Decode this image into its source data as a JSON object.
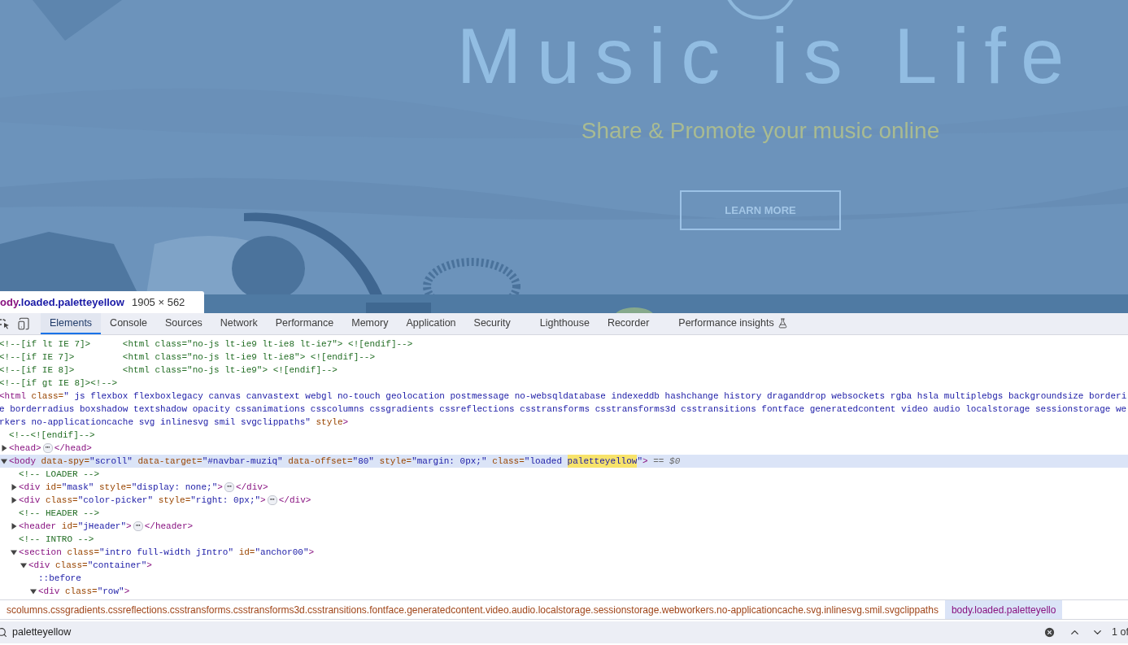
{
  "page": {
    "title": "Music is Life",
    "subtitle": "Share & Promote your music online",
    "button": "LEARN MORE"
  },
  "inspect_tooltip": {
    "tag": "ody",
    "classes": ".loaded.paletteyellow",
    "size": "1905 × 562"
  },
  "tabs": [
    {
      "label": "Elements",
      "selected": true
    },
    {
      "label": "Console",
      "selected": false
    },
    {
      "label": "Sources",
      "selected": false
    },
    {
      "label": "Network",
      "selected": false
    },
    {
      "label": "Performance",
      "selected": false
    },
    {
      "label": "Memory",
      "selected": false
    },
    {
      "label": "Application",
      "selected": false
    },
    {
      "label": "Security",
      "selected": false
    },
    {
      "label": "Lighthouse",
      "selected": false
    },
    {
      "label": "Recorder",
      "selected": false
    },
    {
      "label": "Performance insights",
      "selected": false,
      "experimental": true
    }
  ],
  "dom": [
    {
      "selected": false,
      "lines": [
        {
          "parts": [
            {
              "kind": "comment",
              "text": "<!--[if lt IE 7]>      <html class=\"no-js lt-ie9 lt-ie8 lt-ie7\"> <![endif]-->"
            }
          ]
        }
      ]
    },
    {
      "selected": false,
      "lines": [
        {
          "parts": [
            {
              "kind": "comment",
              "text": "<!--[if IE 7]>         <html class=\"no-js lt-ie9 lt-ie8\"> <![endif]-->"
            }
          ]
        }
      ]
    },
    {
      "selected": false,
      "lines": [
        {
          "parts": [
            {
              "kind": "comment",
              "text": "<!--[if IE 8]>         <html class=\"no-js lt-ie9\"> <![endif]-->"
            }
          ]
        }
      ]
    },
    {
      "selected": false,
      "lines": [
        {
          "parts": [
            {
              "kind": "comment",
              "text": "<!--[if gt IE 8]><!-->"
            }
          ]
        }
      ]
    },
    {
      "selected": false,
      "lines": [
        {
          "parts": [
            {
              "kind": "tag",
              "text": "<html"
            },
            {
              "kind": "attr",
              "text": " class="
            },
            {
              "kind": "value",
              "text": "\" js flexbox flexboxlegacy canvas canvastext webgl no-touch geolocation postmessage no-websqldatabase indexeddb hashchange history draganddrop websockets rgba hsla multiplebgs backgroundsize borderi"
            }
          ]
        },
        {
          "parts": [
            {
              "kind": "value",
              "text": "e borderradius boxshadow textshadow opacity cssanimations csscolumns cssgradients cssreflections csstransforms csstransforms3d csstransitions fontface generatedcontent video audio localstorage sessionstorage we"
            }
          ]
        },
        {
          "parts": [
            {
              "kind": "value",
              "text": "rkers no-applicationcache svg inlinesvg smil svgclippaths\""
            },
            {
              "kind": "attr",
              "text": " style"
            },
            {
              "kind": "tag",
              "text": ">"
            }
          ]
        }
      ],
      "children": [
        {
          "selected": false,
          "lines": [
            {
              "parts": [
                {
                  "kind": "comment",
                  "text": "<!--<![endif]-->"
                }
              ]
            }
          ]
        },
        {
          "selected": false,
          "expanded": false,
          "lines": [
            {
              "parts": [
                {
                  "kind": "tag",
                  "text": "<head>"
                },
                {
                  "kind": "ellipsis",
                  "text": "⋯"
                },
                {
                  "kind": "tag",
                  "text": "</head>"
                }
              ]
            }
          ]
        },
        {
          "selected": true,
          "expanded": true,
          "lines": [
            {
              "parts": [
                {
                  "kind": "tag",
                  "text": "<body"
                },
                {
                  "kind": "attr",
                  "text": " data-spy="
                },
                {
                  "kind": "value",
                  "text": "\"scroll\""
                },
                {
                  "kind": "attr",
                  "text": " data-target="
                },
                {
                  "kind": "value",
                  "text": "\"#navbar-muziq\""
                },
                {
                  "kind": "attr",
                  "text": " data-offset="
                },
                {
                  "kind": "value",
                  "text": "\"80\""
                },
                {
                  "kind": "attr",
                  "text": " style="
                },
                {
                  "kind": "value",
                  "text": "\"margin: 0px;\""
                },
                {
                  "kind": "attr",
                  "text": " class="
                },
                {
                  "kind": "value",
                  "text": "\"loaded "
                },
                {
                  "kind": "match",
                  "text": "paletteyellow"
                },
                {
                  "kind": "value",
                  "text": "\""
                },
                {
                  "kind": "tag",
                  "text": ">"
                },
                {
                  "kind": "ref",
                  "text": " == $0"
                }
              ]
            }
          ],
          "children": [
            {
              "selected": false,
              "lines": [
                {
                  "parts": [
                    {
                      "kind": "comment",
                      "text": "<!-- LOADER -->"
                    }
                  ]
                }
              ]
            },
            {
              "selected": false,
              "expanded": false,
              "lines": [
                {
                  "parts": [
                    {
                      "kind": "tag",
                      "text": "<div"
                    },
                    {
                      "kind": "attr",
                      "text": " id="
                    },
                    {
                      "kind": "value",
                      "text": "\"mask\""
                    },
                    {
                      "kind": "attr",
                      "text": " style="
                    },
                    {
                      "kind": "value",
                      "text": "\"display: none;\""
                    },
                    {
                      "kind": "tag",
                      "text": ">"
                    },
                    {
                      "kind": "ellipsis",
                      "text": "⋯"
                    },
                    {
                      "kind": "tag",
                      "text": "</div>"
                    }
                  ]
                }
              ]
            },
            {
              "selected": false,
              "expanded": false,
              "lines": [
                {
                  "parts": [
                    {
                      "kind": "tag",
                      "text": "<div"
                    },
                    {
                      "kind": "attr",
                      "text": " class="
                    },
                    {
                      "kind": "value",
                      "text": "\"color-picker\""
                    },
                    {
                      "kind": "attr",
                      "text": " style="
                    },
                    {
                      "kind": "value",
                      "text": "\"right: 0px;\""
                    },
                    {
                      "kind": "tag",
                      "text": ">"
                    },
                    {
                      "kind": "ellipsis",
                      "text": "⋯"
                    },
                    {
                      "kind": "tag",
                      "text": "</div>"
                    }
                  ]
                }
              ]
            },
            {
              "selected": false,
              "lines": [
                {
                  "parts": [
                    {
                      "kind": "comment",
                      "text": "<!-- HEADER -->"
                    }
                  ]
                }
              ]
            },
            {
              "selected": false,
              "expanded": false,
              "lines": [
                {
                  "parts": [
                    {
                      "kind": "tag",
                      "text": "<header"
                    },
                    {
                      "kind": "attr",
                      "text": " id="
                    },
                    {
                      "kind": "value",
                      "text": "\"jHeader\""
                    },
                    {
                      "kind": "tag",
                      "text": ">"
                    },
                    {
                      "kind": "ellipsis",
                      "text": "⋯"
                    },
                    {
                      "kind": "tag",
                      "text": "</header>"
                    }
                  ]
                }
              ]
            },
            {
              "selected": false,
              "lines": [
                {
                  "parts": [
                    {
                      "kind": "comment",
                      "text": "<!-- INTRO -->"
                    }
                  ]
                }
              ]
            },
            {
              "selected": false,
              "expanded": true,
              "lines": [
                {
                  "parts": [
                    {
                      "kind": "tag",
                      "text": "<section"
                    },
                    {
                      "kind": "attr",
                      "text": " class="
                    },
                    {
                      "kind": "value",
                      "text": "\"intro full-width jIntro\""
                    },
                    {
                      "kind": "attr",
                      "text": " id="
                    },
                    {
                      "kind": "value",
                      "text": "\"anchor00\""
                    },
                    {
                      "kind": "tag",
                      "text": ">"
                    }
                  ]
                }
              ],
              "children": [
                {
                  "selected": false,
                  "expanded": true,
                  "lines": [
                    {
                      "parts": [
                        {
                          "kind": "tag",
                          "text": "<div"
                        },
                        {
                          "kind": "attr",
                          "text": " class="
                        },
                        {
                          "kind": "value",
                          "text": "\"container\""
                        },
                        {
                          "kind": "tag",
                          "text": ">"
                        }
                      ]
                    }
                  ],
                  "children": [
                    {
                      "selected": false,
                      "lines": [
                        {
                          "parts": [
                            {
                              "kind": "pseudo",
                              "text": "::before"
                            }
                          ]
                        }
                      ]
                    },
                    {
                      "selected": false,
                      "expanded": true,
                      "lines": [
                        {
                          "parts": [
                            {
                              "kind": "tag",
                              "text": "<div"
                            },
                            {
                              "kind": "attr",
                              "text": " class="
                            },
                            {
                              "kind": "value",
                              "text": "\"row\""
                            },
                            {
                              "kind": "tag",
                              "text": ">"
                            }
                          ]
                        }
                      ]
                    }
                  ]
                }
              ]
            }
          ]
        }
      ]
    }
  ],
  "breadcrumbs": [
    {
      "text": "scolumns.cssgradients.cssreflections.csstransforms.csstransforms3d.csstransitions.fontface.generatedcontent.video.audio.localstorage.sessionstorage.webworkers.no-applicationcache.svg.inlinesvg.smil.svgclippaths",
      "selected": false
    },
    {
      "text": "body.loaded.paletteyello",
      "selected": true
    }
  ],
  "search": {
    "value": "paletteyellow",
    "count": "1 of"
  }
}
